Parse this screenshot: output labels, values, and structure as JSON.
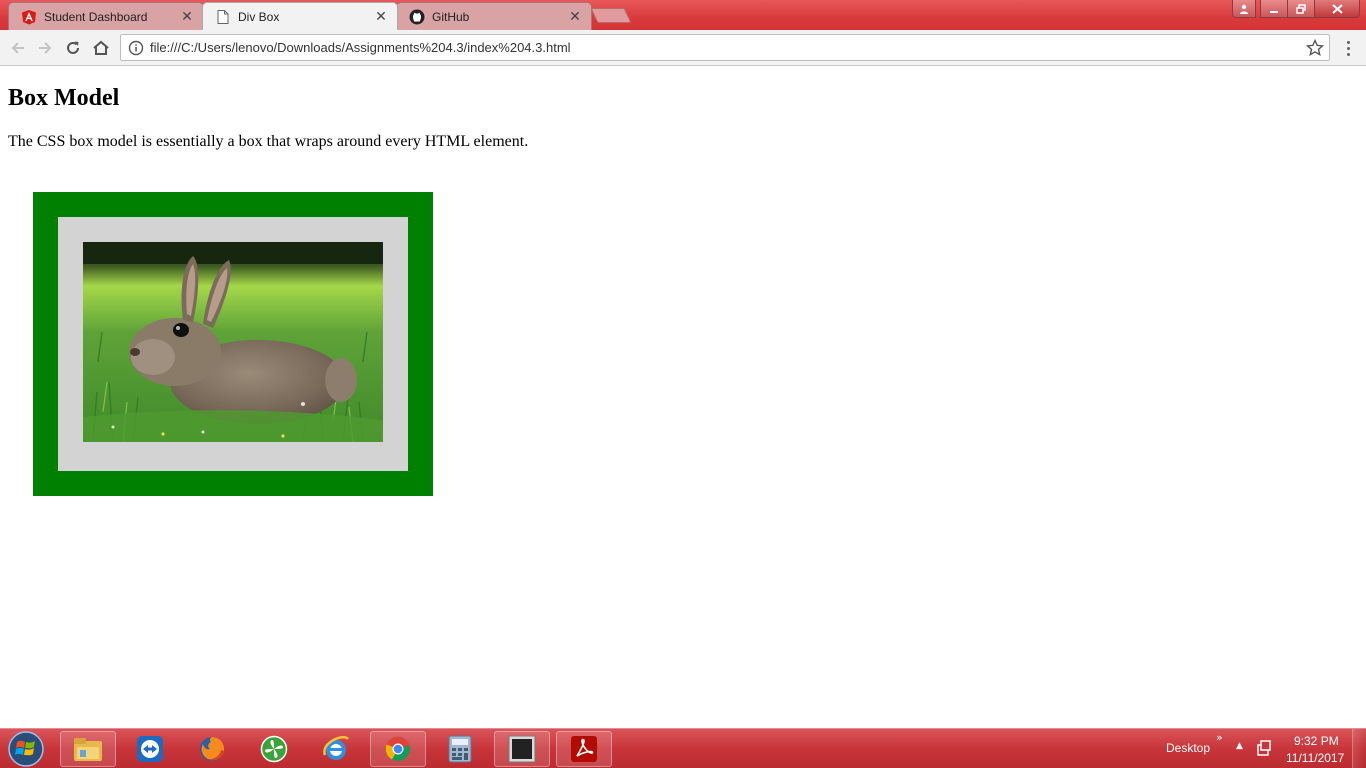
{
  "browser": {
    "tabs": [
      {
        "title": "Student Dashboard",
        "active": false,
        "icon": "angular-icon"
      },
      {
        "title": "Div Box",
        "active": true,
        "icon": "document-icon"
      },
      {
        "title": "GitHub",
        "active": false,
        "icon": "github-icon"
      }
    ],
    "url": "file:///C:/Users/lenovo/Downloads/Assignments%204.3/index%204.3.html"
  },
  "page": {
    "heading": "Box Model",
    "description": "The CSS box model is essentially a box that wraps around every HTML element.",
    "colors": {
      "border": "#008000",
      "padding": "#d3d3d3"
    },
    "image": {
      "subject": "rabbit in grass"
    }
  },
  "taskbar": {
    "pinned": [
      "file-explorer-icon",
      "teamviewer-icon",
      "firefox-icon",
      "clover-icon",
      "internet-explorer-icon",
      "chrome-icon",
      "calculator-icon",
      "console-icon",
      "acrobat-icon"
    ],
    "tray": {
      "desktop_label": "Desktop",
      "chevron": "»"
    },
    "clock": {
      "time": "9:32 PM",
      "date": "11/11/2017"
    }
  },
  "theme": {
    "titlebar": "#d83a3c",
    "taskbar": "#c8353a"
  }
}
